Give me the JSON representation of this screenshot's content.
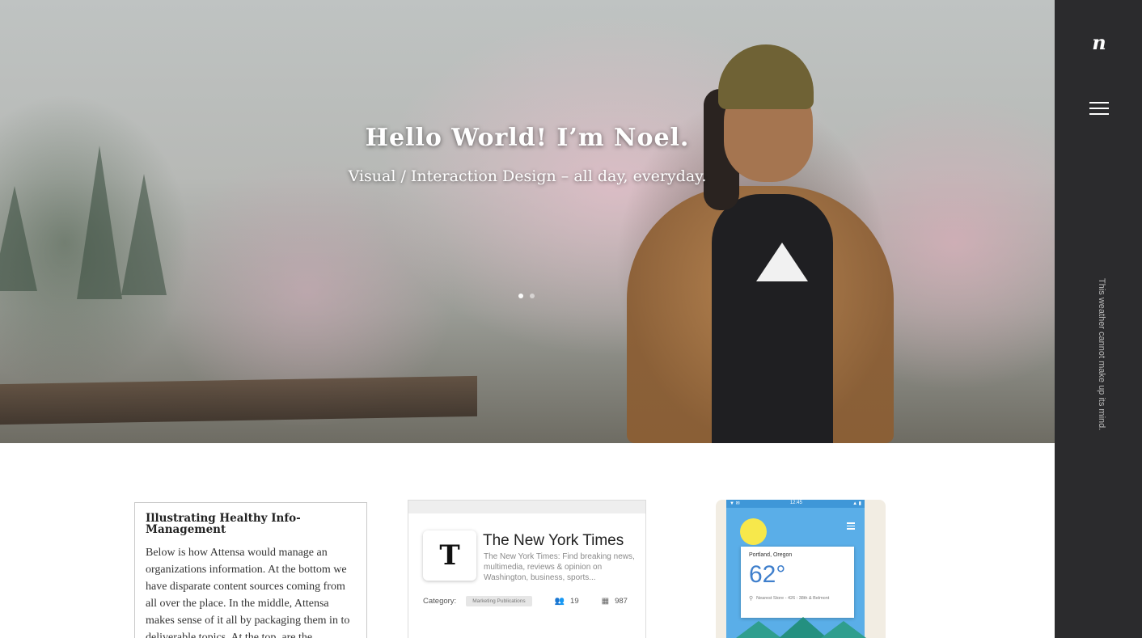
{
  "hero": {
    "title": "Hello World! I’m Noel.",
    "subtitle": "Visual / Interaction Design – all day, everyday.",
    "slides": [
      {
        "label": "1"
      },
      {
        "label": "2"
      }
    ],
    "active_slide": 1
  },
  "sidebar": {
    "logo": "n",
    "menu_icon": "hamburger-menu-icon",
    "tagline": "This weather cannot make up its mind."
  },
  "cards": {
    "text_card": {
      "title": "Illustrating Healthy Info-Management",
      "body": "Below is how Attensa would manage an organizations information. At the bottom we have disparate content sources coming from all over the place. In the middle, Attensa makes sense of it all by packaging them in to deliverable topics. At the top, are the"
    },
    "nyt_card": {
      "logo_glyph": "T",
      "name": "The New York Times",
      "description": "The New York Times: Find breaking news, multimedia, reviews & opinion on Washington, business, sports...",
      "category_label": "Category:",
      "category_value": "Marketing Publications",
      "people_count": "19",
      "doc_count": "987"
    },
    "weather_card": {
      "status_left": "▼ ✉",
      "status_center": "12:45",
      "status_right": "▲ ▮",
      "city": "Portland, Oregon",
      "temperature": "62°",
      "store": "Nearest Store - 426 : 38th & Belmont"
    }
  },
  "colors": {
    "sidebar_bg": "#2b2b2d",
    "weather_blue": "#5aaee8",
    "sun_yellow": "#f7e84b"
  }
}
